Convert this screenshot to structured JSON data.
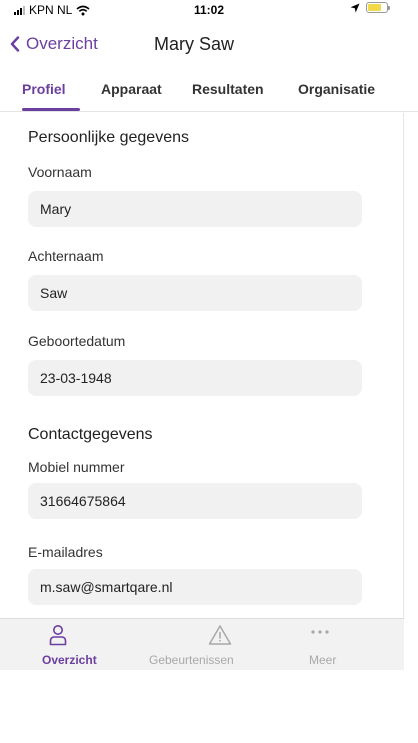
{
  "status_bar": {
    "carrier": "KPN NL",
    "time": "11:02",
    "battery_level": 0.7
  },
  "header": {
    "back_label": "Overzicht",
    "title": "Mary Saw"
  },
  "tabs": [
    {
      "label": "Profiel",
      "active": true
    },
    {
      "label": "Apparaat",
      "active": false
    },
    {
      "label": "Resultaten",
      "active": false
    },
    {
      "label": "Organisatie",
      "active": false
    }
  ],
  "personal": {
    "title": "Persoonlijke gegevens",
    "first_name_label": "Voornaam",
    "first_name": "Mary",
    "last_name_label": "Achternaam",
    "last_name": "Saw",
    "birthdate_label": "Geboortedatum",
    "birthdate": "23-03-1948"
  },
  "contact": {
    "title": "Contactgegevens",
    "mobile_label": "Mobiel nummer",
    "mobile": "31664675864",
    "email_label": "E-mailadres",
    "email": "m.saw@smartqare.nl"
  },
  "bottom_nav": [
    {
      "label": "Overzicht",
      "icon": "person-icon",
      "active": true
    },
    {
      "label": "Gebeurtenissen",
      "icon": "warning-icon",
      "active": false
    },
    {
      "label": "Meer",
      "icon": "more-icon",
      "active": false
    }
  ],
  "colors": {
    "accent": "#6b3fa0",
    "field_bg": "#f1f1f1",
    "inactive": "#a8a8a8"
  }
}
